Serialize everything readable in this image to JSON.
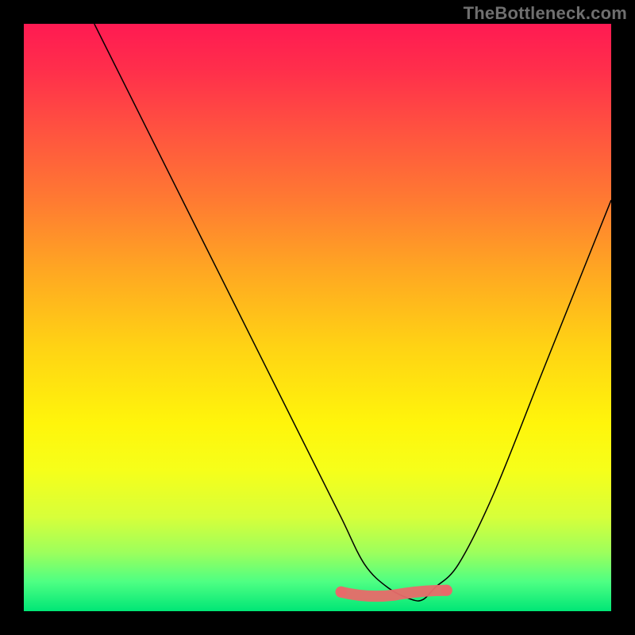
{
  "watermark": "TheBottleneck.com",
  "chart_data": {
    "type": "line",
    "title": "",
    "xlabel": "",
    "ylabel": "",
    "xlim": [
      0,
      100
    ],
    "ylim": [
      0,
      100
    ],
    "grid": false,
    "background": "rainbow-vertical-gradient",
    "series": [
      {
        "name": "bottleneck-curve",
        "x": [
          12,
          20,
          30,
          40,
          48,
          54,
          58,
          62,
          66,
          68,
          70,
          74,
          80,
          88,
          96,
          100
        ],
        "y": [
          100,
          84,
          64,
          44,
          28,
          16,
          8,
          4,
          2,
          2,
          4,
          8,
          20,
          40,
          60,
          70
        ],
        "color": "#000000"
      }
    ],
    "highlight": {
      "name": "optimal-range",
      "x_range": [
        54,
        72
      ],
      "y_approx": 3,
      "color": "#e86a6a"
    },
    "colors": {
      "gradient_stops": [
        {
          "pos": 0.0,
          "color": "#ff1a52"
        },
        {
          "pos": 0.3,
          "color": "#ff7a32"
        },
        {
          "pos": 0.55,
          "color": "#ffd314"
        },
        {
          "pos": 0.76,
          "color": "#f6ff1a"
        },
        {
          "pos": 0.95,
          "color": "#4eff83"
        },
        {
          "pos": 1.0,
          "color": "#00e676"
        }
      ],
      "frame": "#000000"
    }
  }
}
